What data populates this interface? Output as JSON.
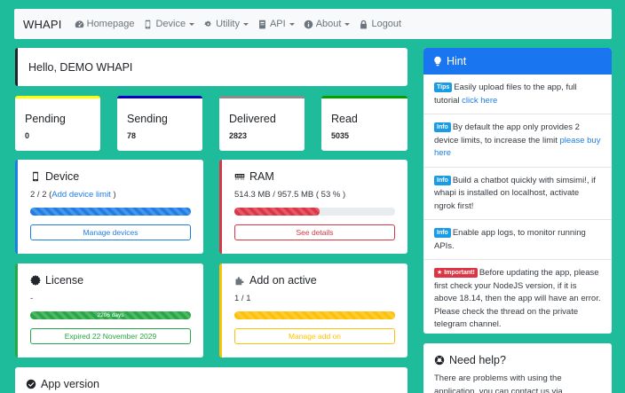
{
  "nav": {
    "brand": "WHAPI",
    "items": [
      {
        "label": "Homepage",
        "icon": "dashboard-icon",
        "dropdown": false
      },
      {
        "label": "Device",
        "icon": "mobile-icon",
        "dropdown": true
      },
      {
        "label": "Utility",
        "icon": "cogs-icon",
        "dropdown": true
      },
      {
        "label": "API",
        "icon": "book-icon",
        "dropdown": true
      },
      {
        "label": "About",
        "icon": "info-icon",
        "dropdown": true
      },
      {
        "label": "Logout",
        "icon": "lock-icon",
        "dropdown": false
      }
    ]
  },
  "greeting": "Hello, DEMO WHAPI",
  "stats": [
    {
      "label": "Pending",
      "value": "0",
      "color": "#ffff00"
    },
    {
      "label": "Sending",
      "value": "78",
      "color": "#0000c8"
    },
    {
      "label": "Delivered",
      "value": "2823",
      "color": "#8c8c8c"
    },
    {
      "label": "Read",
      "value": "5035",
      "color": "#00a000"
    }
  ],
  "device": {
    "title": "Device",
    "count": "2 / 2 (",
    "link": "Add device limit",
    "close": " )",
    "progress": 1.0,
    "button": "Manage devices",
    "color": "#1e7ee6"
  },
  "ram": {
    "title": "RAM",
    "usage": "514.3 MB / 957.5 MB ( 53 % )",
    "progress": 0.53,
    "button": "See details",
    "color": "#dc3545"
  },
  "license": {
    "title": "License",
    "text": "-",
    "progress": 1.0,
    "bar_label": "2206 days",
    "button": "Expired 22 November 2029",
    "color": "#28a745"
  },
  "addon": {
    "title": "Add on active",
    "count": "1 / 1",
    "progress": 1.0,
    "button": "Manage add on",
    "color": "#ffc107"
  },
  "hint": {
    "title": "Hint",
    "items": [
      {
        "badge": "Tips",
        "badge_color": "blue",
        "text": "Easily upload files to the app, full tutorial ",
        "link": "click here",
        "tail": ""
      },
      {
        "badge": "Info",
        "badge_color": "blue",
        "text": "By default the app only provides 2 device limits, to increase the limit ",
        "link": "please buy here",
        "tail": ""
      },
      {
        "badge": "Info",
        "badge_color": "blue",
        "text": "Build a chatbot quickly with simsimi!, if whapi is installed on localhost, activate ngrok first!",
        "link": "",
        "tail": ""
      },
      {
        "badge": "Info",
        "badge_color": "blue",
        "text": "Enable app logs, to monitor running APIs.",
        "link": "",
        "tail": ""
      },
      {
        "badge": "Important!",
        "badge_color": "red",
        "text": "Before updating the app, please first check your NodeJS version, if it is above 18.14, then the app will have an error. Please check the thread on the private telegram channel.",
        "link": "",
        "tail": ""
      }
    ]
  },
  "help": {
    "title": "Need help?",
    "text": "There are problems with using the application, you can contact us via"
  },
  "app_version": {
    "title": "App version"
  }
}
